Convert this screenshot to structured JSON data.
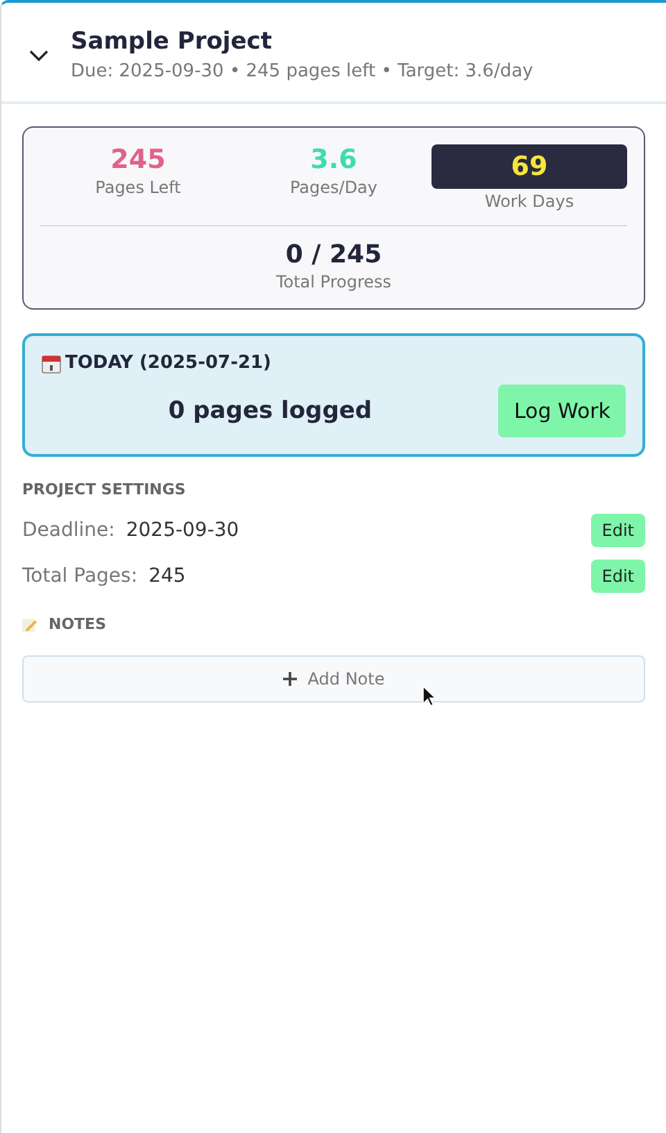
{
  "header": {
    "title": "Sample Project",
    "subtitle": "Due: 2025-09-30 • 245 pages left • Target: 3.6/day",
    "expanded": true
  },
  "stats": [
    {
      "value": "245",
      "label": "Pages Left",
      "color": "#e0628a",
      "highlighted": false
    },
    {
      "value": "3.6",
      "label": "Pages/Day",
      "color": "#3fdcae",
      "highlighted": false
    },
    {
      "value": "69",
      "label": "Work Days",
      "color": "#f5e63a",
      "highlighted": true
    }
  ],
  "progress": {
    "value": "0 / 245",
    "label": "Total Progress"
  },
  "today": {
    "title": "TODAY (2025-07-21)",
    "logged": "0 pages logged",
    "button": "Log Work"
  },
  "settings": {
    "heading": "PROJECT SETTINGS",
    "rows": [
      {
        "label": "Deadline:",
        "value": "2025-09-30",
        "button": "Edit"
      },
      {
        "label": "Total Pages:",
        "value": "245",
        "button": "Edit"
      }
    ]
  },
  "notes": {
    "heading": "NOTES",
    "button": "Add Note"
  }
}
